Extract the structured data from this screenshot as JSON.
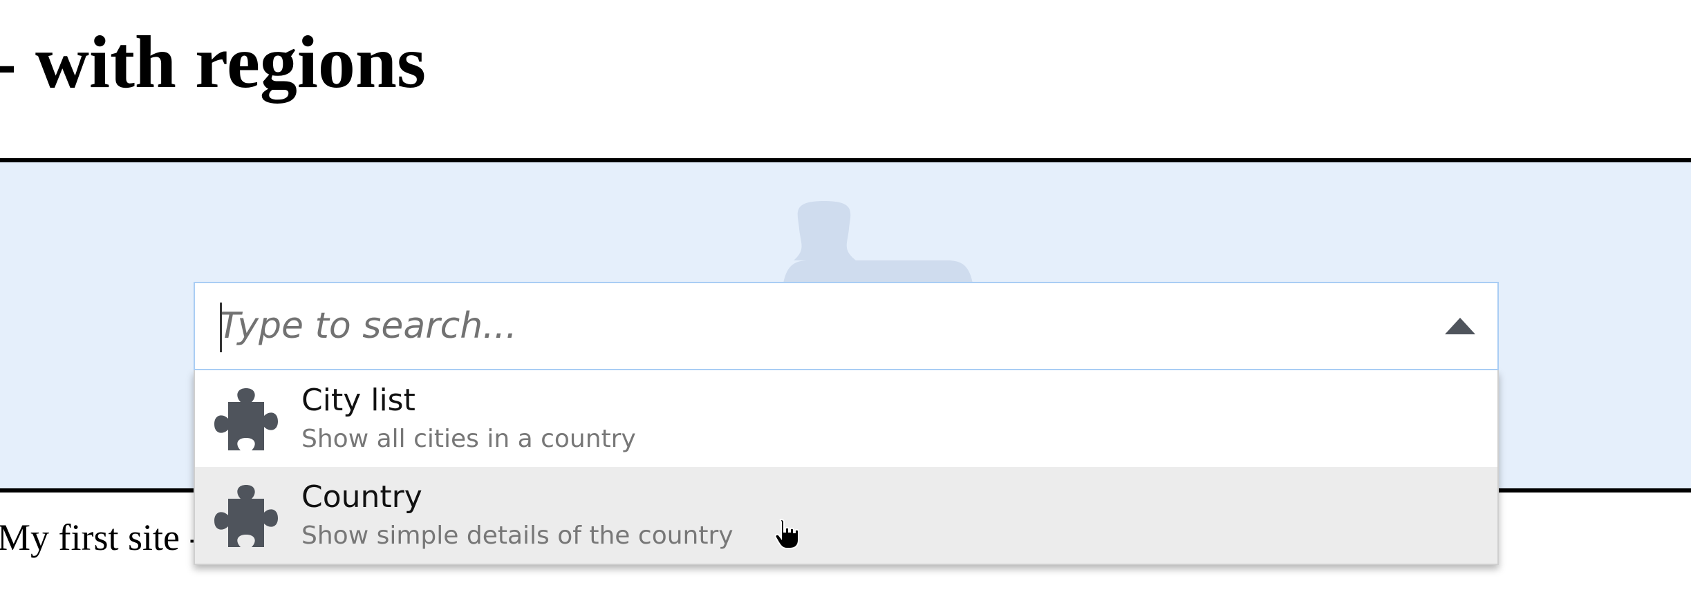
{
  "header": {
    "title": "- with regions"
  },
  "footer": {
    "text": "My first site -"
  },
  "search": {
    "placeholder": "Type to search...",
    "value": ""
  },
  "dropdown": {
    "options": [
      {
        "title": "City list",
        "description": "Show all cities in a country",
        "icon": "puzzle-piece-icon"
      },
      {
        "title": "Country",
        "description": "Show simple details of the country",
        "icon": "puzzle-piece-icon"
      }
    ],
    "hovered_option": "Country"
  },
  "colors": {
    "region_background": "#e5effb",
    "input_border": "#a9cdf4",
    "icon": "#4f545c",
    "hover_background": "#ececec"
  }
}
